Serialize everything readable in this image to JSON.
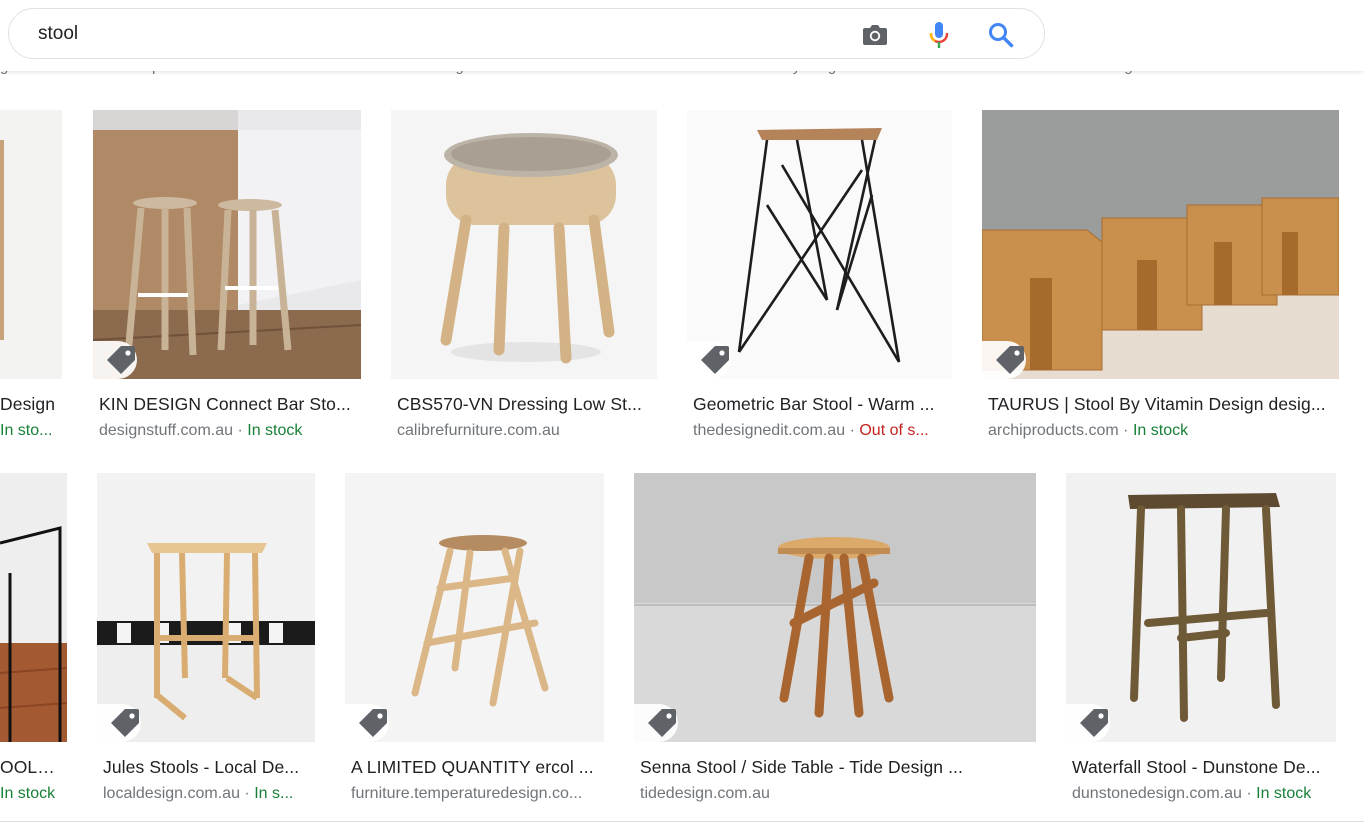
{
  "search": {
    "query": "stool"
  },
  "peek": [
    {
      "text": "gn.com.au",
      "stock": ""
    },
    {
      "text": "templeandwebster.com.au · ",
      "stock": "In st..."
    },
    {
      "text": "designfarm.com.au · ",
      "stock": "In stock"
    },
    {
      "text": "loombydesign.com.au · ",
      "stock": "In stock"
    },
    {
      "text": "thedesignhunter.com.au · ",
      "stock": "In st..."
    }
  ],
  "row1": [
    {
      "title": "Design",
      "site": "",
      "stock": "In sto...",
      "stock_class": "in"
    },
    {
      "title": "KIN DESIGN Connect Bar Sto...",
      "site": "designstuff.com.au",
      "stock": "In stock",
      "stock_class": "in"
    },
    {
      "title": "CBS570-VN Dressing Low St...",
      "site": "calibrefurniture.com.au",
      "stock": "",
      "stock_class": ""
    },
    {
      "title": "Geometric Bar Stool - Warm ...",
      "site": "thedesignedit.com.au",
      "stock": "Out of s...",
      "stock_class": "out"
    },
    {
      "title": "TAURUS | Stool By Vitamin Design desig...",
      "site": "archiproducts.com",
      "stock": "In stock",
      "stock_class": "in"
    }
  ],
  "row2": [
    {
      "title": "OOLS...",
      "site": "",
      "stock": "In stock",
      "stock_class": "in"
    },
    {
      "title": "Jules Stools - Local De...",
      "site": "localdesign.com.au",
      "stock": "In s...",
      "stock_class": "in"
    },
    {
      "title": "A LIMITED QUANTITY ercol ...",
      "site": "furniture.temperaturedesign.co...",
      "stock": "",
      "stock_class": ""
    },
    {
      "title": "Senna Stool / Side Table - Tide Design ...",
      "site": "tidedesign.com.au",
      "stock": "",
      "stock_class": ""
    },
    {
      "title": "Waterfall Stool - Dunstone De...",
      "site": "dunstonedesign.com.au",
      "stock": "In stock",
      "stock_class": "in"
    }
  ],
  "separator": "·",
  "colors": {
    "in_stock": "#188038",
    "out_of_stock": "#c5221f",
    "mic_blue": "#4285f4",
    "mic_red": "#ea4335",
    "mic_yellow": "#fbbc05",
    "mic_green": "#34a853"
  }
}
